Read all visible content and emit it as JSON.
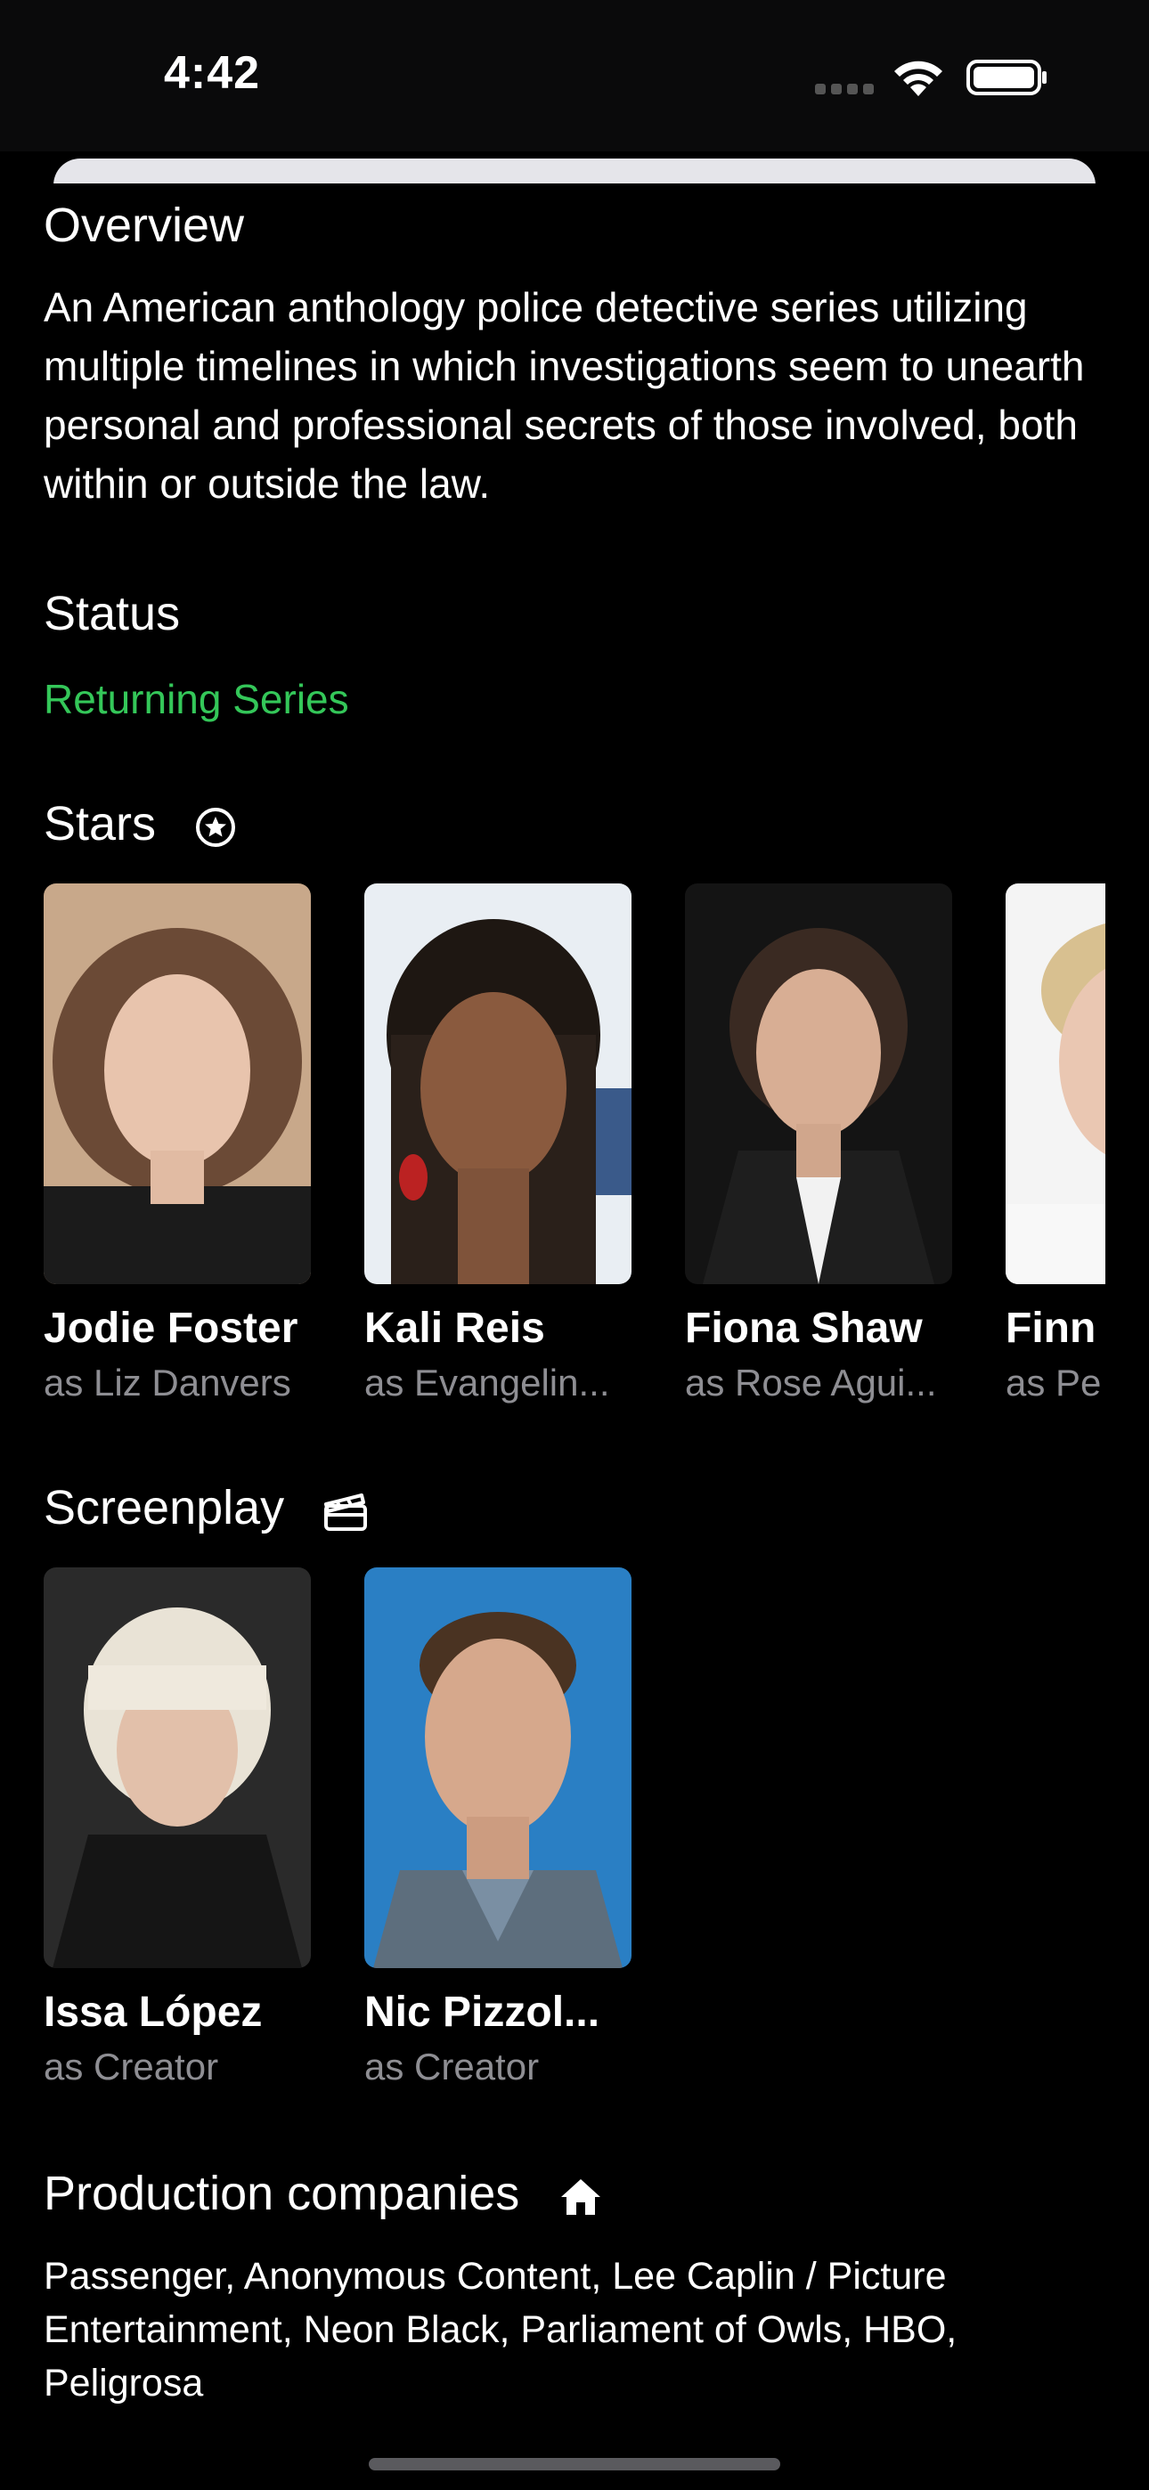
{
  "status_bar": {
    "time": "4:42"
  },
  "overview": {
    "title": "Overview",
    "text": "An American anthology police detective series utilizing multiple timelines in which investigations seem to unearth personal and professional secrets of those involved, both within or outside the law."
  },
  "status": {
    "title": "Status",
    "value": "Returning Series",
    "color": "#34c759"
  },
  "stars": {
    "title": "Stars",
    "icon": "star-circle-icon",
    "items": [
      {
        "name": "Jodie Foster",
        "role": "as Liz Danvers"
      },
      {
        "name": "Kali Reis",
        "role": "as Evangelin..."
      },
      {
        "name": "Fiona Shaw",
        "role": "as Rose Agui..."
      },
      {
        "name": "Finn",
        "role": "as Pe"
      }
    ]
  },
  "screenplay": {
    "title": "Screenplay",
    "icon": "clapperboard-icon",
    "items": [
      {
        "name": "Issa López",
        "role": "as Creator"
      },
      {
        "name": "Nic Pizzol...",
        "role": "as Creator"
      }
    ]
  },
  "production": {
    "title": "Production companies",
    "icon": "house-icon",
    "text": "Passenger, Anonymous Content, Lee Caplin / Picture Entertainment, Neon Black, Parliament of Owls, HBO, Peligrosa"
  }
}
